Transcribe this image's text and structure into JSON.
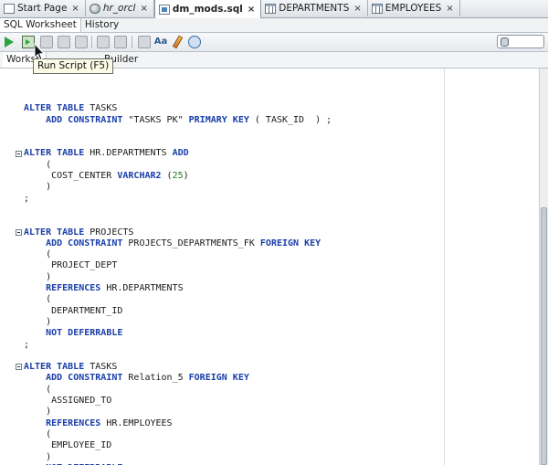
{
  "tabs": [
    {
      "label": "Start Page",
      "icon": "document-icon",
      "closable": true
    },
    {
      "label": "hr_orcl",
      "icon": "connection-icon",
      "closable": true,
      "italic": true
    },
    {
      "label": "dm_mods.sql",
      "icon": "sql-file-icon",
      "closable": true,
      "active": true
    },
    {
      "label": "DEPARTMENTS",
      "icon": "table-icon",
      "closable": true
    },
    {
      "label": "EMPLOYEES",
      "icon": "table-icon",
      "closable": true
    }
  ],
  "close_glyph": "×",
  "worksheet_tabs": [
    "SQL Worksheet",
    "History"
  ],
  "toolbar": {
    "run_statement": "run-statement-icon",
    "run_script": "run-script-icon",
    "run_script_tooltip": "Run Script (F5)",
    "connection_selector": "database-icon"
  },
  "modes": {
    "worksheet": "Worksh",
    "query_builder": "Builder"
  },
  "editor": {
    "code": [
      {
        "text": ""
      },
      {
        "parts": [
          {
            "kw": "ALTER TABLE"
          },
          {
            "t": " TASKS"
          }
        ]
      },
      {
        "parts": [
          {
            "t": "    "
          },
          {
            "kw": "ADD CONSTRAINT"
          },
          {
            "t": " \"TASKS PK\" "
          },
          {
            "kw": "PRIMARY KEY"
          },
          {
            "t": " ( TASK_ID  ) ;"
          }
        ]
      },
      {
        "text": ""
      },
      {
        "text": ""
      },
      {
        "parts": [
          {
            "kw": "ALTER TABLE"
          },
          {
            "t": " HR.DEPARTMENTS "
          },
          {
            "kw": "ADD"
          }
        ],
        "fold": true
      },
      {
        "parts": [
          {
            "t": "    ("
          }
        ]
      },
      {
        "parts": [
          {
            "t": "     COST_CENTER "
          },
          {
            "kw": "VARCHAR2"
          },
          {
            "t": " ("
          },
          {
            "num": "25"
          },
          {
            "t": ")"
          }
        ]
      },
      {
        "parts": [
          {
            "t": "    )"
          }
        ]
      },
      {
        "parts": [
          {
            "t": ";"
          }
        ]
      },
      {
        "text": ""
      },
      {
        "text": ""
      },
      {
        "parts": [
          {
            "kw": "ALTER TABLE"
          },
          {
            "t": " PROJECTS"
          }
        ],
        "fold": true
      },
      {
        "parts": [
          {
            "t": "    "
          },
          {
            "kw": "ADD CONSTRAINT"
          },
          {
            "t": " PROJECTS_DEPARTMENTS_FK "
          },
          {
            "kw": "FOREIGN KEY"
          }
        ]
      },
      {
        "parts": [
          {
            "t": "    ("
          }
        ]
      },
      {
        "parts": [
          {
            "t": "     PROJECT_DEPT"
          }
        ]
      },
      {
        "parts": [
          {
            "t": "    )"
          }
        ]
      },
      {
        "parts": [
          {
            "t": "    "
          },
          {
            "kw": "REFERENCES"
          },
          {
            "t": " HR.DEPARTMENTS"
          }
        ]
      },
      {
        "parts": [
          {
            "t": "    ("
          }
        ]
      },
      {
        "parts": [
          {
            "t": "     DEPARTMENT_ID"
          }
        ]
      },
      {
        "parts": [
          {
            "t": "    )"
          }
        ]
      },
      {
        "parts": [
          {
            "t": "    "
          },
          {
            "kw": "NOT DEFERRABLE"
          }
        ]
      },
      {
        "parts": [
          {
            "t": ";"
          }
        ]
      },
      {
        "text": ""
      },
      {
        "parts": [
          {
            "kw": "ALTER TABLE"
          },
          {
            "t": " TASKS"
          }
        ],
        "fold": true
      },
      {
        "parts": [
          {
            "t": "    "
          },
          {
            "kw": "ADD CONSTRAINT"
          },
          {
            "t": " Relation_5 "
          },
          {
            "kw": "FOREIGN KEY"
          }
        ]
      },
      {
        "parts": [
          {
            "t": "    ("
          }
        ]
      },
      {
        "parts": [
          {
            "t": "     ASSIGNED_TO"
          }
        ]
      },
      {
        "parts": [
          {
            "t": "    )"
          }
        ]
      },
      {
        "parts": [
          {
            "t": "    "
          },
          {
            "kw": "REFERENCES"
          },
          {
            "t": " HR.EMPLOYEES"
          }
        ]
      },
      {
        "parts": [
          {
            "t": "    ("
          }
        ]
      },
      {
        "parts": [
          {
            "t": "     EMPLOYEE_ID"
          }
        ]
      },
      {
        "parts": [
          {
            "t": "    )"
          }
        ]
      },
      {
        "parts": [
          {
            "t": "    "
          },
          {
            "kw": "NOT DEFERRABLE"
          }
        ]
      }
    ]
  },
  "colors": {
    "keyword": "#1a3fa8",
    "number": "#207a1f",
    "run_green": "#2aa33a"
  }
}
